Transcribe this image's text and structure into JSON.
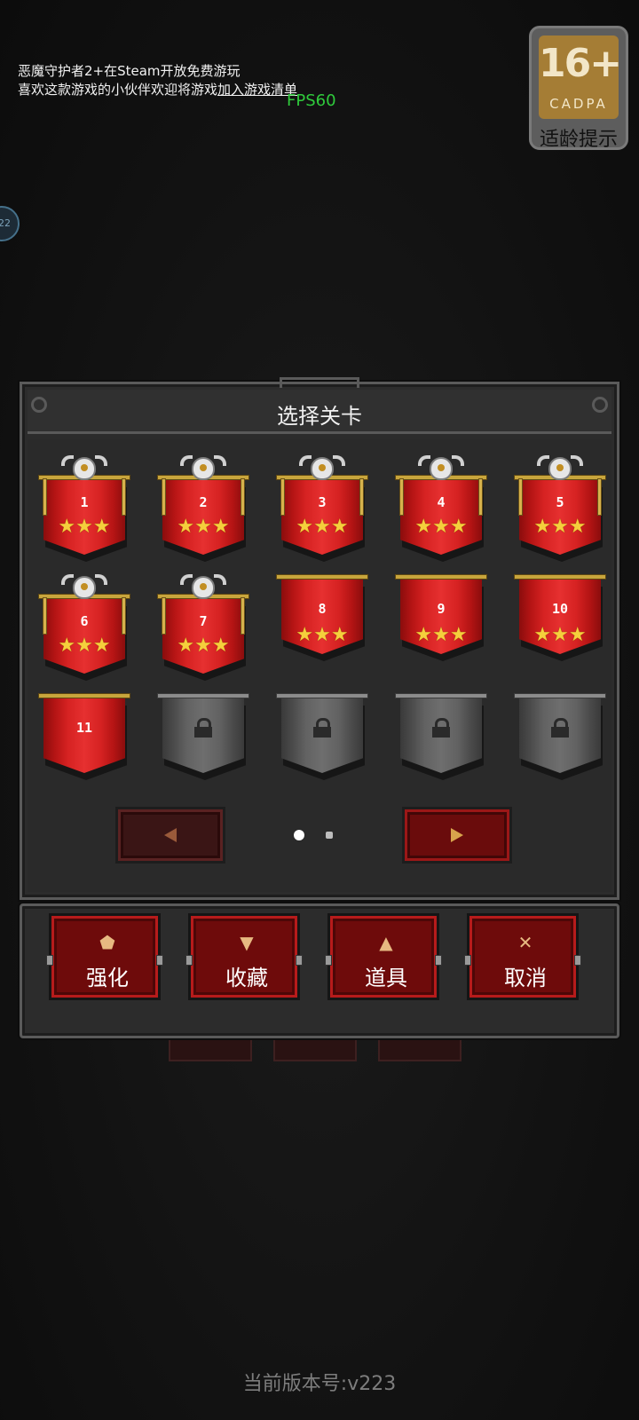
{
  "notice": {
    "line1": "恶魔守护者2+在Steam开放免费游玩",
    "line2_prefix": "喜欢这款游戏的小伙伴欢迎将游戏",
    "line2_link": "加入游戏清单"
  },
  "fps": "FPS60",
  "age_badge": {
    "rating": "16+",
    "org": "CADPA",
    "label": "适龄提示"
  },
  "side_bubble": "22",
  "dialog": {
    "title": "选择关卡"
  },
  "levels": [
    {
      "number": "1",
      "stars": "★★★",
      "state": "crested"
    },
    {
      "number": "2",
      "stars": "★★★",
      "state": "crested"
    },
    {
      "number": "3",
      "stars": "★★★",
      "state": "crested"
    },
    {
      "number": "4",
      "stars": "★★★",
      "state": "crested"
    },
    {
      "number": "5",
      "stars": "★★★",
      "state": "crested"
    },
    {
      "number": "6",
      "stars": "★★★",
      "state": "crested"
    },
    {
      "number": "7",
      "stars": "★★★",
      "state": "crested"
    },
    {
      "number": "8",
      "stars": "★★★",
      "state": "plain"
    },
    {
      "number": "9",
      "stars": "★★★",
      "state": "plain"
    },
    {
      "number": "10",
      "stars": "★★★",
      "state": "plain"
    },
    {
      "number": "11",
      "stars": "",
      "state": "plain"
    },
    {
      "number": "",
      "stars": "",
      "state": "locked"
    },
    {
      "number": "",
      "stars": "",
      "state": "locked"
    },
    {
      "number": "",
      "stars": "",
      "state": "locked"
    },
    {
      "number": "",
      "stars": "",
      "state": "locked"
    }
  ],
  "pager": {
    "current_page": 1,
    "total_pages": 2
  },
  "actions": [
    {
      "label": "强化",
      "icon": "⬟",
      "icon_name": "upgrade-icon"
    },
    {
      "label": "收藏",
      "icon": "▼",
      "icon_name": "trophy-icon"
    },
    {
      "label": "道具",
      "icon": "▲",
      "icon_name": "potion-icon"
    },
    {
      "label": "取消",
      "icon": "✕",
      "icon_name": "close-icon"
    }
  ],
  "version": "当前版本号:v223",
  "colors": {
    "banner_red": "#d62222",
    "star_gold": "#f5cf3c",
    "fps_green": "#2fcb3c",
    "badge_gold": "#a57d35"
  }
}
